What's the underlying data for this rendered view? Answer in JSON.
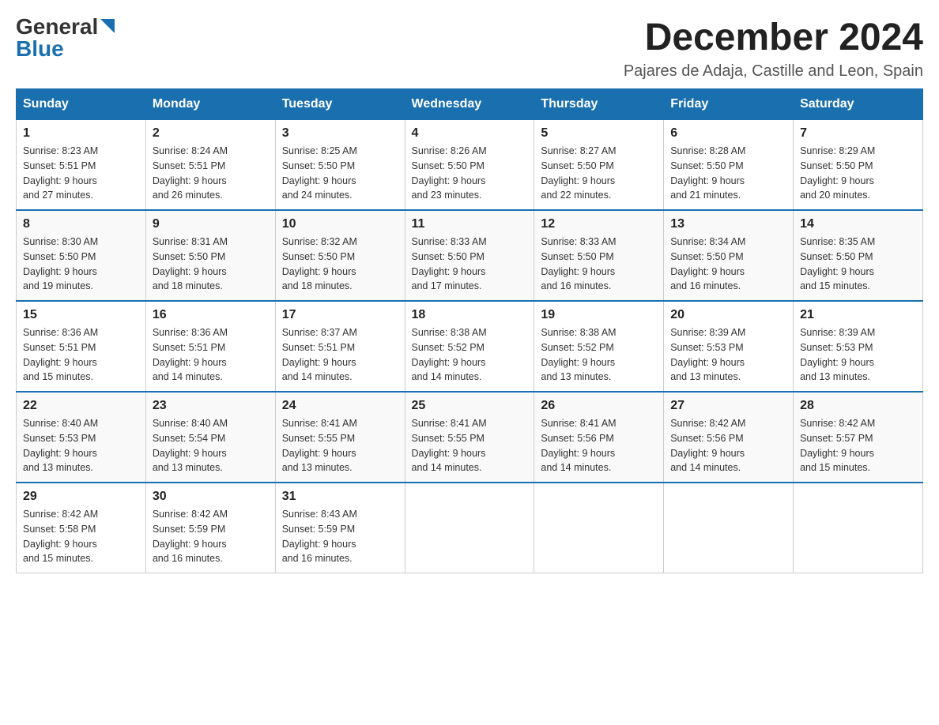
{
  "logo": {
    "general": "General",
    "triangle_char": "▶",
    "blue": "Blue"
  },
  "title": "December 2024",
  "location": "Pajares de Adaja, Castille and Leon, Spain",
  "days_of_week": [
    "Sunday",
    "Monday",
    "Tuesday",
    "Wednesday",
    "Thursday",
    "Friday",
    "Saturday"
  ],
  "weeks": [
    [
      {
        "day": "1",
        "sunrise": "8:23 AM",
        "sunset": "5:51 PM",
        "daylight": "9 hours and 27 minutes."
      },
      {
        "day": "2",
        "sunrise": "8:24 AM",
        "sunset": "5:51 PM",
        "daylight": "9 hours and 26 minutes."
      },
      {
        "day": "3",
        "sunrise": "8:25 AM",
        "sunset": "5:50 PM",
        "daylight": "9 hours and 24 minutes."
      },
      {
        "day": "4",
        "sunrise": "8:26 AM",
        "sunset": "5:50 PM",
        "daylight": "9 hours and 23 minutes."
      },
      {
        "day": "5",
        "sunrise": "8:27 AM",
        "sunset": "5:50 PM",
        "daylight": "9 hours and 22 minutes."
      },
      {
        "day": "6",
        "sunrise": "8:28 AM",
        "sunset": "5:50 PM",
        "daylight": "9 hours and 21 minutes."
      },
      {
        "day": "7",
        "sunrise": "8:29 AM",
        "sunset": "5:50 PM",
        "daylight": "9 hours and 20 minutes."
      }
    ],
    [
      {
        "day": "8",
        "sunrise": "8:30 AM",
        "sunset": "5:50 PM",
        "daylight": "9 hours and 19 minutes."
      },
      {
        "day": "9",
        "sunrise": "8:31 AM",
        "sunset": "5:50 PM",
        "daylight": "9 hours and 18 minutes."
      },
      {
        "day": "10",
        "sunrise": "8:32 AM",
        "sunset": "5:50 PM",
        "daylight": "9 hours and 18 minutes."
      },
      {
        "day": "11",
        "sunrise": "8:33 AM",
        "sunset": "5:50 PM",
        "daylight": "9 hours and 17 minutes."
      },
      {
        "day": "12",
        "sunrise": "8:33 AM",
        "sunset": "5:50 PM",
        "daylight": "9 hours and 16 minutes."
      },
      {
        "day": "13",
        "sunrise": "8:34 AM",
        "sunset": "5:50 PM",
        "daylight": "9 hours and 16 minutes."
      },
      {
        "day": "14",
        "sunrise": "8:35 AM",
        "sunset": "5:50 PM",
        "daylight": "9 hours and 15 minutes."
      }
    ],
    [
      {
        "day": "15",
        "sunrise": "8:36 AM",
        "sunset": "5:51 PM",
        "daylight": "9 hours and 15 minutes."
      },
      {
        "day": "16",
        "sunrise": "8:36 AM",
        "sunset": "5:51 PM",
        "daylight": "9 hours and 14 minutes."
      },
      {
        "day": "17",
        "sunrise": "8:37 AM",
        "sunset": "5:51 PM",
        "daylight": "9 hours and 14 minutes."
      },
      {
        "day": "18",
        "sunrise": "8:38 AM",
        "sunset": "5:52 PM",
        "daylight": "9 hours and 14 minutes."
      },
      {
        "day": "19",
        "sunrise": "8:38 AM",
        "sunset": "5:52 PM",
        "daylight": "9 hours and 13 minutes."
      },
      {
        "day": "20",
        "sunrise": "8:39 AM",
        "sunset": "5:53 PM",
        "daylight": "9 hours and 13 minutes."
      },
      {
        "day": "21",
        "sunrise": "8:39 AM",
        "sunset": "5:53 PM",
        "daylight": "9 hours and 13 minutes."
      }
    ],
    [
      {
        "day": "22",
        "sunrise": "8:40 AM",
        "sunset": "5:53 PM",
        "daylight": "9 hours and 13 minutes."
      },
      {
        "day": "23",
        "sunrise": "8:40 AM",
        "sunset": "5:54 PM",
        "daylight": "9 hours and 13 minutes."
      },
      {
        "day": "24",
        "sunrise": "8:41 AM",
        "sunset": "5:55 PM",
        "daylight": "9 hours and 13 minutes."
      },
      {
        "day": "25",
        "sunrise": "8:41 AM",
        "sunset": "5:55 PM",
        "daylight": "9 hours and 14 minutes."
      },
      {
        "day": "26",
        "sunrise": "8:41 AM",
        "sunset": "5:56 PM",
        "daylight": "9 hours and 14 minutes."
      },
      {
        "day": "27",
        "sunrise": "8:42 AM",
        "sunset": "5:56 PM",
        "daylight": "9 hours and 14 minutes."
      },
      {
        "day": "28",
        "sunrise": "8:42 AM",
        "sunset": "5:57 PM",
        "daylight": "9 hours and 15 minutes."
      }
    ],
    [
      {
        "day": "29",
        "sunrise": "8:42 AM",
        "sunset": "5:58 PM",
        "daylight": "9 hours and 15 minutes."
      },
      {
        "day": "30",
        "sunrise": "8:42 AM",
        "sunset": "5:59 PM",
        "daylight": "9 hours and 16 minutes."
      },
      {
        "day": "31",
        "sunrise": "8:43 AM",
        "sunset": "5:59 PM",
        "daylight": "9 hours and 16 minutes."
      },
      null,
      null,
      null,
      null
    ]
  ],
  "labels": {
    "sunrise": "Sunrise:",
    "sunset": "Sunset:",
    "daylight": "Daylight:"
  }
}
